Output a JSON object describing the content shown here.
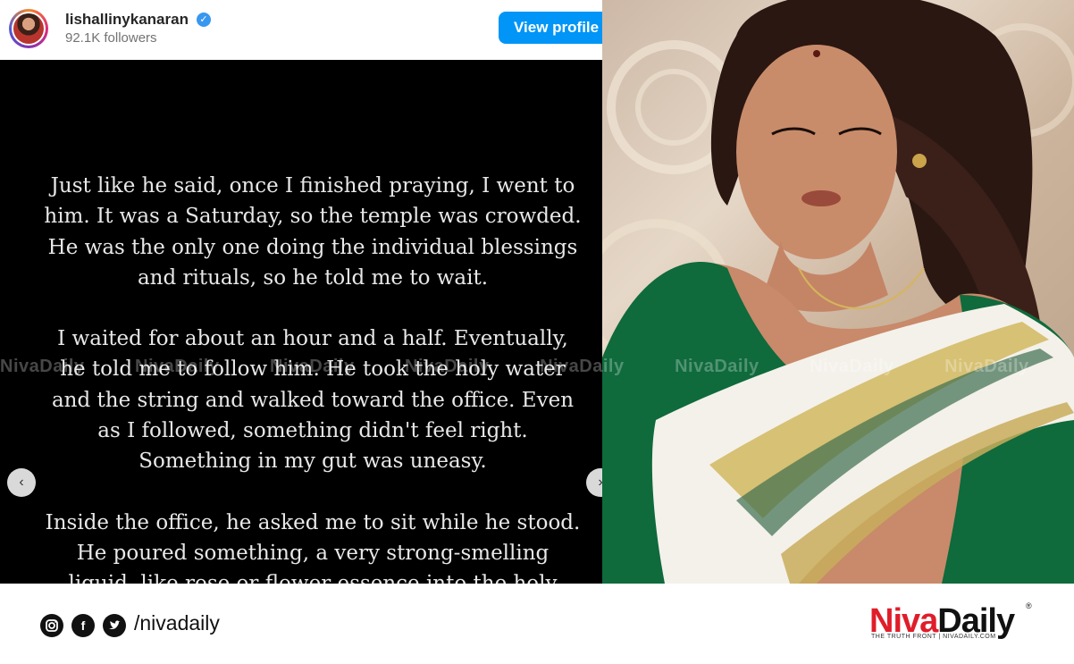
{
  "instagram": {
    "username": "lishallinykanaran",
    "followers": "92.1K followers",
    "view_profile_label": "View profile",
    "verified_icon": "verified-badge-icon",
    "post_paragraphs": [
      "Just like he said, once I finished praying, I went to\nhim. It was a Saturday, so the temple was crowded.\nHe was the only one doing the individual blessings\nand rituals, so he told me to wait.",
      "I waited for about an hour and a half. Eventually,\nhe told me to follow him. He took the holy water\nand the string and walked toward the office. Even\nas I followed, something didn't feel right.\nSomething in my gut was uneasy.",
      "Inside the office, he asked me to sit while he stood.\nHe poured something, a very strong-smelling\nliquid, like rose or flower essence into the holy"
    ],
    "nav_prev_icon": "chevron-left-icon",
    "nav_next_icon": "chevron-right-icon"
  },
  "watermark": {
    "text": "NivaDaily"
  },
  "footer": {
    "handle": "/nivadaily",
    "social_icons": [
      "instagram-icon",
      "facebook-icon",
      "twitter-icon"
    ],
    "brand_part1": "Niva",
    "brand_part2": "Daily",
    "brand_registered": "®",
    "tagline": "THE TRUTH FRONT | NIVADAILY.COM",
    "brand_red": "#e01d2a"
  }
}
